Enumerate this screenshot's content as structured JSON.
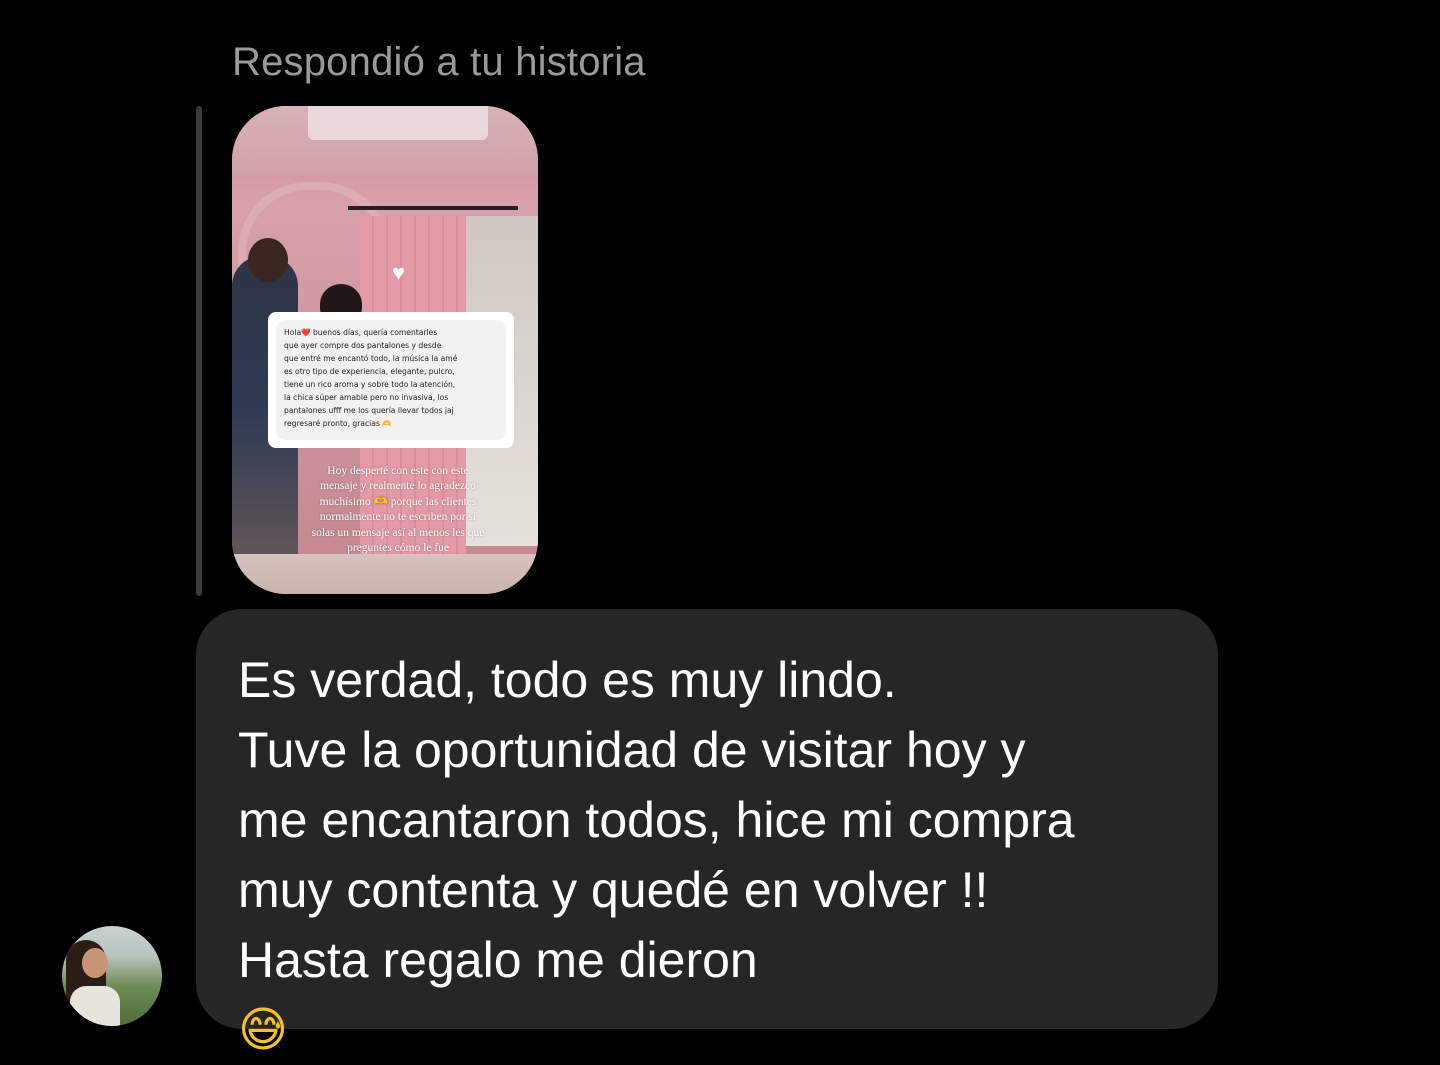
{
  "reply_header": {
    "label": "Respondió a tu historia"
  },
  "story_preview": {
    "heart_icon": "heart-icon",
    "message_lines": [
      "Hola❤️ buenos días, quería comentarles",
      "que ayer compre dos pantalones y desde",
      "que entré me encantó todo, la música la amé",
      "es otro tipo de experiencia, elegante, pulcro,",
      "tiene un rico aroma y sobre todo la atención,",
      "la chica súper amable pero no invasiva, los",
      "pantalones ufff me los quería llevar todos jaj",
      "regresaré pronto, gracias 🫶"
    ],
    "caption_lines": [
      "Hoy desperté con este con este",
      "mensaje y realmente lo agradezco",
      "muchísimo 🫶 porque las clientes",
      "normalmente no te escriben por sí",
      "solas un mensaje así al menos les que",
      "preguntes cómo le fue"
    ]
  },
  "message": {
    "lines": [
      "Es verdad, todo es muy lindo.",
      "Tuve la oportunidad de visitar hoy y",
      "me encantaron todos, hice mi compra",
      "muy contenta y quedé en volver !!",
      "Hasta regalo me dieron"
    ],
    "emoji": "😅"
  },
  "sender": {
    "avatar_icon": "user-avatar"
  }
}
